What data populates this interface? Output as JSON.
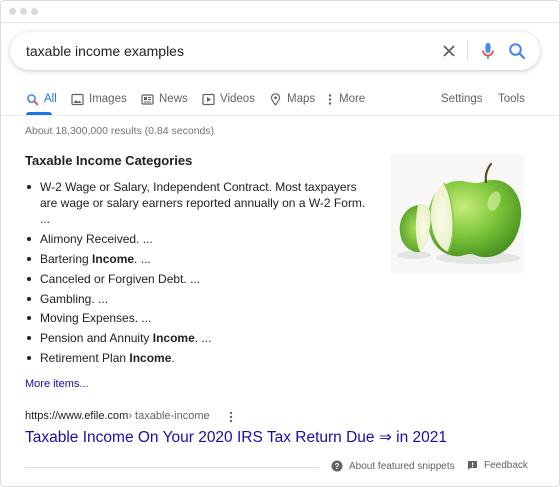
{
  "search": {
    "query": "taxable income examples"
  },
  "tabs": [
    {
      "label": "All"
    },
    {
      "label": "Images"
    },
    {
      "label": "News"
    },
    {
      "label": "Videos"
    },
    {
      "label": "Maps"
    },
    {
      "label": "More"
    }
  ],
  "tools": {
    "settings": "Settings",
    "tools": "Tools"
  },
  "result_stats": "About 18,300,000 results (0.84 seconds)",
  "featured_snippet": {
    "title": "Taxable Income Categories",
    "items": [
      {
        "text": "W-2 Wage or Salary, Independent Contract. Most taxpayers are wage or salary earners reported annually on a W-2 Form. ...",
        "bold": ""
      },
      {
        "text": "Alimony Received. ...",
        "bold": ""
      },
      {
        "pre": "Bartering ",
        "bold": "Income",
        "post": ". ..."
      },
      {
        "text": "Canceled or Forgiven Debt. ...",
        "bold": ""
      },
      {
        "text": "Gambling. ...",
        "bold": ""
      },
      {
        "text": "Moving Expenses. ...",
        "bold": ""
      },
      {
        "pre": "Pension and Annuity ",
        "bold": "Income",
        "post": ". ..."
      },
      {
        "pre": "Retirement Plan ",
        "bold": "Income",
        "post": "."
      }
    ],
    "more_items": "More items...",
    "image_subject": "green-apple-image"
  },
  "result": {
    "url_domain": "https://www.efile.com",
    "url_path": " › taxable-income",
    "title": "Taxable Income On Your 2020 IRS Tax Return Due ⇒ in 2021"
  },
  "footer": {
    "about": "About featured snippets",
    "separator": "•",
    "feedback": "Feedback"
  },
  "colors": {
    "link": "#1a0dab",
    "accent": "#1a73e8",
    "muted": "#70757a"
  }
}
